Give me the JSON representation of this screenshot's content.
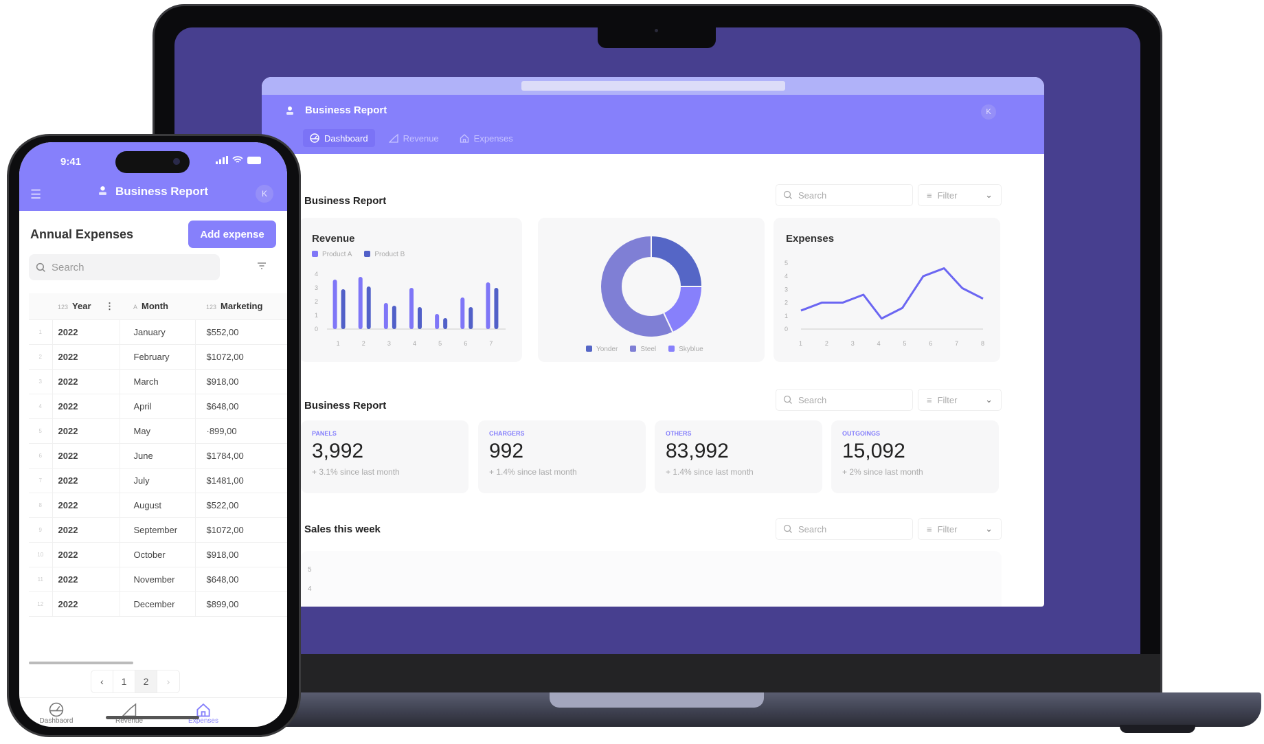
{
  "laptop": {
    "app_title": "Business Report",
    "avatar_initial": "K",
    "tabs": [
      {
        "label": "Dashboard",
        "icon": "gauge-icon",
        "active": true
      },
      {
        "label": "Revenue",
        "icon": "chart-icon",
        "active": false
      },
      {
        "label": "Expenses",
        "icon": "home-icon",
        "active": false
      }
    ],
    "sections": [
      {
        "title": "Business Report",
        "search_placeholder": "Search",
        "filter_label": "Filter"
      },
      {
        "title": "Business Report",
        "search_placeholder": "Search",
        "filter_label": "Filter"
      },
      {
        "title": "Sales this week",
        "search_placeholder": "Search",
        "filter_label": "Filter"
      }
    ],
    "kpis": [
      {
        "label": "PANELS",
        "value": "3,992",
        "change": "+ 3.1% since last month"
      },
      {
        "label": "CHARGERS",
        "value": "992",
        "change": "+ 1.4% since last month"
      },
      {
        "label": "OTHERS",
        "value": "83,992",
        "change": "+ 1.4% since last month"
      },
      {
        "label": "OUTGOINGS",
        "value": "15,092",
        "change": "+ 2% since last month"
      }
    ],
    "sales_chart": {
      "ytick_labels": [
        "5",
        "4"
      ]
    }
  },
  "colors": {
    "accent": "#8680fb",
    "accent_dark": "#5160c8",
    "steel": "#7f7fd5",
    "screen_bg": "#473f8f"
  },
  "chart_data": [
    {
      "type": "bar",
      "title": "Revenue",
      "categories": [
        "1",
        "2",
        "3",
        "4",
        "5",
        "6",
        "7"
      ],
      "series": [
        {
          "name": "Product A",
          "color": "#7f76f7",
          "values": [
            3.6,
            3.8,
            1.9,
            3.0,
            1.1,
            2.3,
            3.4
          ]
        },
        {
          "name": "Product B",
          "color": "#5160c8",
          "values": [
            2.9,
            3.1,
            1.7,
            1.6,
            0.8,
            1.6,
            3.0
          ]
        }
      ],
      "yticks": [
        0,
        1,
        2,
        3,
        4
      ],
      "ylim": [
        0,
        4.2
      ],
      "legend": "top-left"
    },
    {
      "type": "pie",
      "title": "",
      "slices": [
        {
          "name": "Yonder",
          "value": 25,
          "color": "#5566c6"
        },
        {
          "name": "Skyblue",
          "value": 18,
          "color": "#8780fb"
        },
        {
          "name": "Steel",
          "value": 57,
          "color": "#7f7fd5"
        }
      ],
      "legend_order": [
        "Yonder",
        "Steel",
        "Skyblue"
      ],
      "legend": "bottom"
    },
    {
      "type": "line",
      "title": "Expenses",
      "x": [
        1,
        1.8,
        2.6,
        3.4,
        4.1,
        4.9,
        5.7,
        6.5,
        7.2,
        8
      ],
      "series": [
        {
          "name": "Expenses",
          "color": "#6b66f2",
          "values": [
            1.4,
            2.0,
            2.0,
            2.6,
            0.8,
            1.6,
            4.0,
            4.6,
            3.1,
            2.3
          ]
        }
      ],
      "xticks": [
        1,
        2,
        3,
        4,
        5,
        6,
        7,
        8
      ],
      "yticks": [
        0,
        1,
        2,
        3,
        4,
        5
      ],
      "ylim": [
        0,
        5.2
      ]
    }
  ],
  "phone": {
    "time": "9:41",
    "app_title": "Business Report",
    "avatar_initial": "K",
    "page_title": "Annual Expenses",
    "add_button": "Add expense",
    "search_placeholder": "Search",
    "columns": [
      {
        "type_badge": "123",
        "label": "Year"
      },
      {
        "type_badge": "A",
        "label": "Month"
      },
      {
        "type_badge": "123",
        "label": "Marketing"
      }
    ],
    "rows": [
      {
        "idx": "1",
        "year": "2022",
        "month": "January",
        "marketing": "$552,00"
      },
      {
        "idx": "2",
        "year": "2022",
        "month": "February",
        "marketing": "$1072,00"
      },
      {
        "idx": "3",
        "year": "2022",
        "month": "March",
        "marketing": "$918,00"
      },
      {
        "idx": "4",
        "year": "2022",
        "month": "April",
        "marketing": "$648,00"
      },
      {
        "idx": "5",
        "year": "2022",
        "month": "May",
        "marketing": "·899,00"
      },
      {
        "idx": "6",
        "year": "2022",
        "month": "June",
        "marketing": "$1784,00"
      },
      {
        "idx": "7",
        "year": "2022",
        "month": "July",
        "marketing": "$1481,00"
      },
      {
        "idx": "8",
        "year": "2022",
        "month": "August",
        "marketing": "$522,00"
      },
      {
        "idx": "9",
        "year": "2022",
        "month": "September",
        "marketing": "$1072,00"
      },
      {
        "idx": "10",
        "year": "2022",
        "month": "October",
        "marketing": "$918,00"
      },
      {
        "idx": "11",
        "year": "2022",
        "month": "November",
        "marketing": "$648,00"
      },
      {
        "idx": "12",
        "year": "2022",
        "month": "December",
        "marketing": "$899,00"
      }
    ],
    "pagination": {
      "prev": "‹",
      "pages": [
        "1",
        "2"
      ],
      "current": "2",
      "next": "›"
    },
    "tabbar": [
      {
        "label": "Dashbaord",
        "icon": "gauge-icon",
        "active": false
      },
      {
        "label": "Revenue",
        "icon": "chart-icon",
        "active": false
      },
      {
        "label": "Expenses",
        "icon": "home-icon",
        "active": true
      }
    ]
  }
}
